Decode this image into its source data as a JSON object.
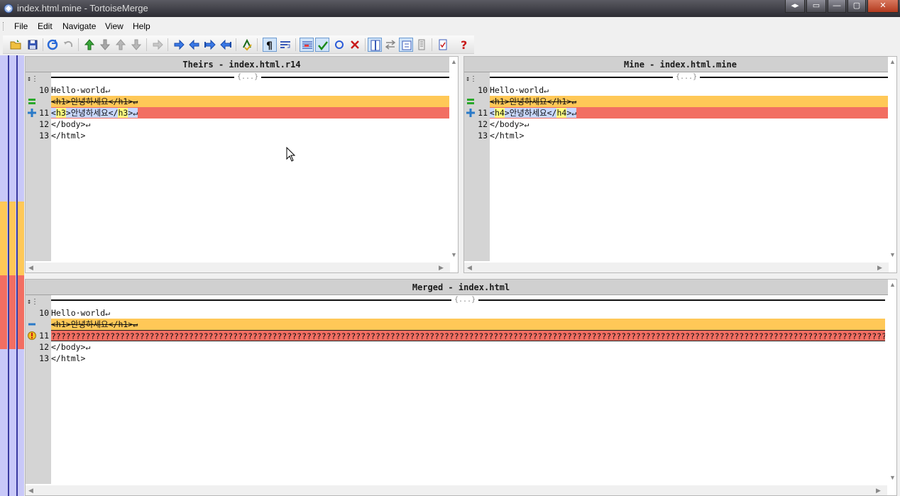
{
  "window": {
    "title": "index.html.mine - TortoiseMerge"
  },
  "menu": [
    "File",
    "Edit",
    "Navigate",
    "View",
    "Help"
  ],
  "toolbar": {
    "icons": [
      "open-icon",
      "save-icon",
      "reload-icon",
      "undo-icon",
      "next-diff-icon",
      "prev-diff-icon",
      "first-conflict-icon",
      "last-conflict-icon",
      "next-inline-icon",
      "next-conflict-icon",
      "prev-conflict-icon",
      "next-change-icon",
      "prev-change-icon",
      "spellcheck-icon",
      "whitespace-icon",
      "wrap-icon",
      "inline-diff-icon",
      "mark-resolved-icon",
      "circle-icon",
      "remove-icon",
      "one-pane-icon",
      "swap-icon",
      "collapse-icon",
      "line-diff-icon",
      "settings-icon",
      "help-icon"
    ]
  },
  "panes": {
    "theirs": {
      "title": "Theirs - index.html.r14",
      "collapse_label": "{...}",
      "lines": [
        {
          "num": "10",
          "text": "Hello·world↵",
          "state": "normal"
        },
        {
          "num": "",
          "text": "<h1>안녕하세요</h1>↵",
          "state": "removed"
        },
        {
          "num": "11",
          "pre": "<",
          "tag": "h3",
          "mid": ">안녕하세요</",
          "tag2": "h3",
          "post": ">↵",
          "state": "conflict"
        },
        {
          "num": "12",
          "text": "</body>↵",
          "state": "normal"
        },
        {
          "num": "13",
          "text": "</html>",
          "state": "normal"
        }
      ]
    },
    "mine": {
      "title": "Mine - index.html.mine",
      "collapse_label": "{...}",
      "lines": [
        {
          "num": "10",
          "text": "Hello·world↵",
          "state": "normal"
        },
        {
          "num": "",
          "text": "<h1>안녕하세요</h1>↵",
          "state": "removed"
        },
        {
          "num": "11",
          "pre": "<",
          "tag": "h4",
          "mid": ">안녕하세요</",
          "tag2": "h4",
          "post": ">↵",
          "state": "conflict"
        },
        {
          "num": "12",
          "text": "</body>↵",
          "state": "normal"
        },
        {
          "num": "13",
          "text": "</html>",
          "state": "normal"
        }
      ]
    },
    "merged": {
      "title": "Merged - index.html",
      "collapse_label": "{...}",
      "lines": [
        {
          "num": "10",
          "text": "Hello·world↵",
          "state": "normal"
        },
        {
          "num": "",
          "text": "<h1>안녕하세요</h1>↵",
          "state": "removed"
        },
        {
          "num": "11",
          "text": "????????????????????????????????????????????????????????????????????????????????????????????????????????????????????????????????????????????????????????????????????????????????????????????????????????",
          "state": "conflicted"
        },
        {
          "num": "12",
          "text": "</body>↵",
          "state": "normal"
        },
        {
          "num": "13",
          "text": "</html>",
          "state": "normal"
        }
      ]
    }
  },
  "colors": {
    "removed": "#ffc857",
    "conflict": "#f26e62",
    "location_bar": "#c8c8f8"
  }
}
